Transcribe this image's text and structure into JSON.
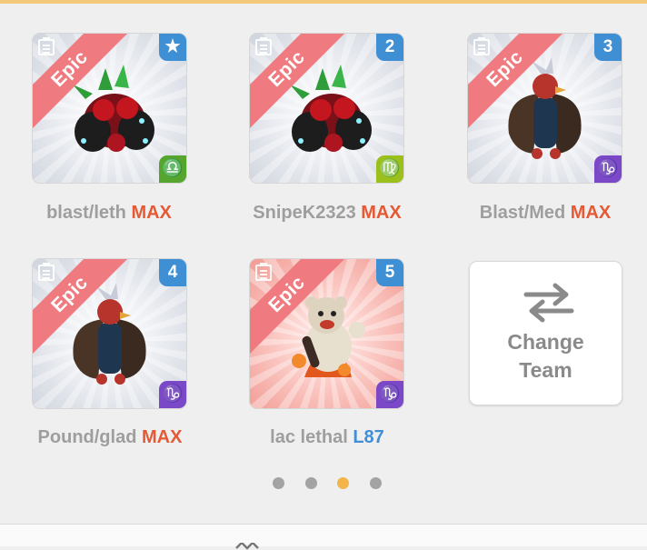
{
  "colors": {
    "accent_top": "#f2c879",
    "rarity_ribbon": "#ef7b80",
    "badge_blue": "#3e8fd4",
    "level_max": "#e55a34",
    "level_number": "#3f8ed6",
    "dot_active": "#f3b54a",
    "dot_inactive": "#a3a3a3"
  },
  "team": [
    {
      "rarity": "Epic",
      "slot": "★",
      "slot_icon": "star-icon",
      "element": "♎",
      "element_icon": "libra-icon",
      "element_color": "#56a52f",
      "name": "blast/leth",
      "level": "MAX",
      "monster_icon": "fire-plant-monster-icon",
      "bg": "gray"
    },
    {
      "rarity": "Epic",
      "slot": "2",
      "element": "♍",
      "element_icon": "virgo-icon",
      "element_color": "#9bc01c",
      "name": "SnipeK2323",
      "level": "MAX",
      "monster_icon": "fire-plant-monster-icon",
      "bg": "gray"
    },
    {
      "rarity": "Epic",
      "slot": "3",
      "element": "♑",
      "element_icon": "capricorn-icon",
      "element_color": "#7b49c8",
      "name": "Blast/Med",
      "level": "MAX",
      "monster_icon": "bird-warrior-monster-icon",
      "bg": "gray"
    },
    {
      "rarity": "Epic",
      "slot": "4",
      "element": "♑",
      "element_icon": "capricorn-icon",
      "element_color": "#7b49c8",
      "name": "Pound/glad",
      "level": "MAX",
      "monster_icon": "bird-warrior-monster-icon",
      "bg": "gray"
    },
    {
      "rarity": "Epic",
      "slot": "5",
      "element": "♑",
      "element_icon": "capricorn-icon",
      "element_color": "#7b49c8",
      "name": "lac lethal",
      "level": "L87",
      "monster_icon": "bear-fire-monster-icon",
      "bg": "red"
    }
  ],
  "change_team": {
    "label": "Change\nTeam",
    "icon": "swap-arrows-icon"
  },
  "pager": {
    "total": 4,
    "active_index": 3
  }
}
